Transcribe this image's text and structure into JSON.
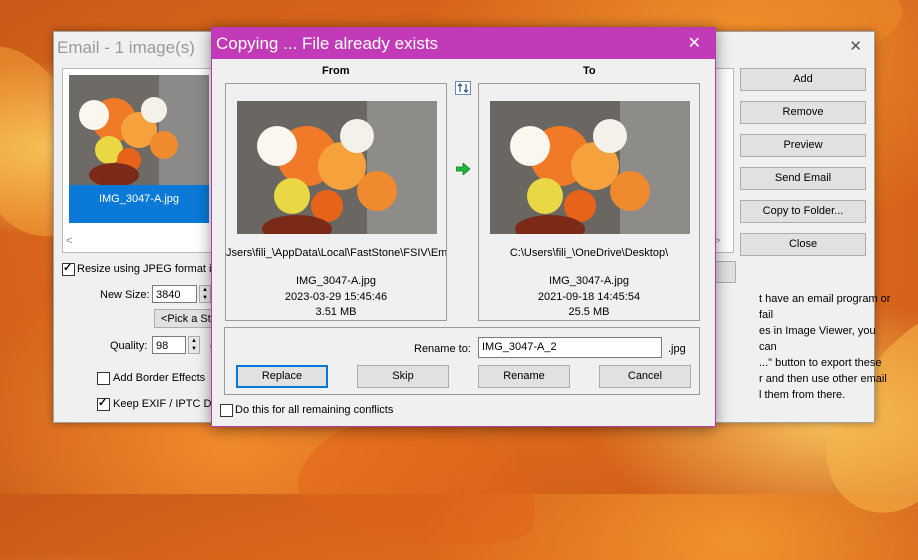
{
  "email_window": {
    "title": "Email  -  1 image(s)",
    "close_glyph": "✕",
    "thumbnail_caption": "IMG_3047-A.jpg",
    "scroll_left": "<",
    "scroll_right": ">",
    "buttons": {
      "add": "Add",
      "remove": "Remove",
      "preview": "Preview",
      "send_email": "Send Email",
      "copy_to_folder": "Copy to Folder...",
      "close": "Close"
    },
    "resize_label": "Resize using JPEG format if p",
    "new_size_label": "New Size:",
    "new_size_value": "3840",
    "preset_label": "<Pick a Sta",
    "quality_label": "Quality:",
    "quality_value": "98",
    "quality_suffix": "(",
    "border_effects_label": "Add Border Effects",
    "keep_exif_label": "Keep EXIF / IPTC Da",
    "info_lines": [
      "t have an email program or fail",
      "es in Image Viewer, you can",
      "...\" button to export these",
      "r and then use other email",
      "l them from there."
    ]
  },
  "dialog": {
    "title": "Copying ...   File already exists",
    "close_glyph": "✕",
    "from_header": "From",
    "to_header": "To",
    "from": {
      "path": "Jsers\\fili_\\AppData\\Local\\FastStone\\FSIV\\Em",
      "filename": "IMG_3047-A.jpg",
      "date": "2023-03-29 15:45:46",
      "size": "3.51 MB"
    },
    "to": {
      "path": "C:\\Users\\fili_\\OneDrive\\Desktop\\",
      "filename": "IMG_3047-A.jpg",
      "date": "2021-09-18 14:45:54",
      "size": "25.5 MB"
    },
    "rename_label": "Rename to:",
    "rename_value": "IMG_3047-A_2",
    "rename_ext": ".jpg",
    "buttons": {
      "replace": "Replace",
      "skip": "Skip",
      "rename": "Rename",
      "cancel": "Cancel"
    },
    "do_all_label": "Do this for all remaining conflicts",
    "accent_color": "#c23ab8"
  }
}
